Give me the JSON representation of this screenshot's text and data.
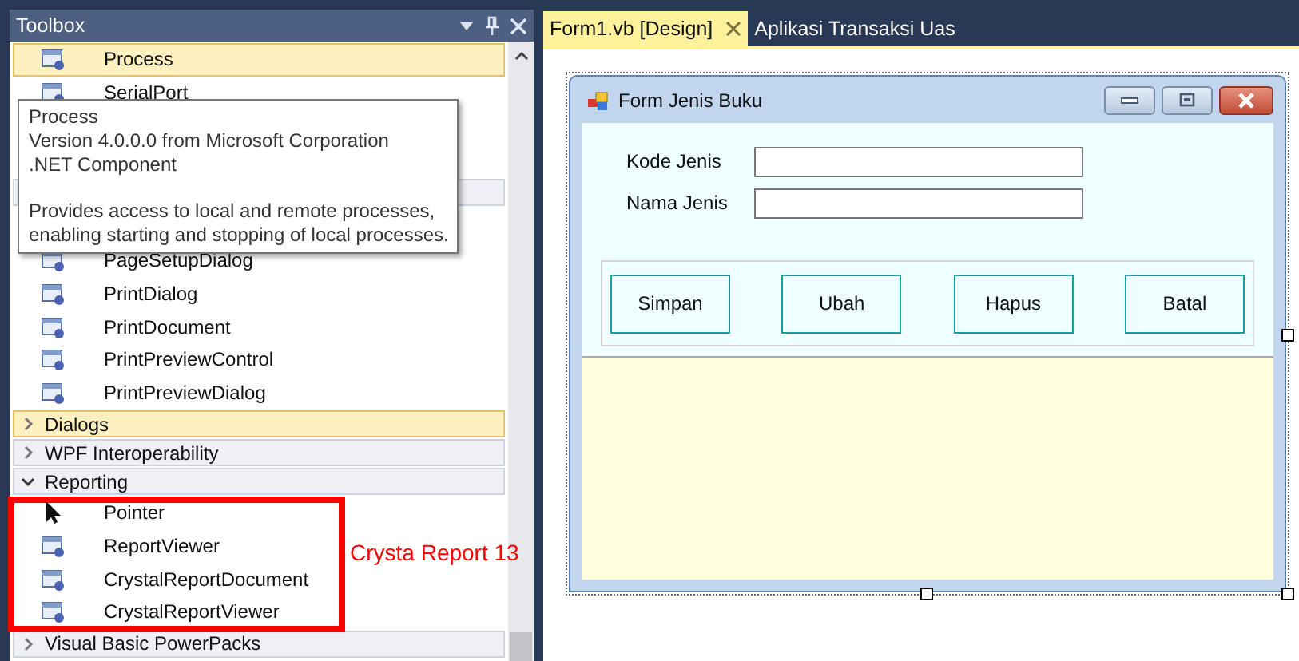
{
  "toolbox": {
    "title": "Toolbox",
    "top_items": [
      {
        "label": "Process",
        "kind": "component",
        "selected": true
      },
      {
        "label": "SerialPort",
        "kind": "component",
        "selected": false
      }
    ],
    "items": [
      {
        "label": "PageSetupDialog",
        "kind": "component",
        "selected": false
      },
      {
        "label": "PrintDialog",
        "kind": "component",
        "selected": false
      },
      {
        "label": "PrintDocument",
        "kind": "component",
        "selected": false
      },
      {
        "label": "PrintPreviewControl",
        "kind": "component",
        "selected": false
      },
      {
        "label": "PrintPreviewDialog",
        "kind": "component",
        "selected": false
      }
    ],
    "categories": [
      {
        "label": "Dialogs",
        "expanded": false,
        "selected": true
      },
      {
        "label": "WPF Interoperability",
        "expanded": false,
        "selected": false
      },
      {
        "label": "Reporting",
        "expanded": true,
        "selected": false,
        "items": [
          {
            "label": "Pointer",
            "kind": "pointer",
            "selected": false
          },
          {
            "label": "ReportViewer",
            "kind": "component",
            "selected": false
          },
          {
            "label": "CrystalReportDocument",
            "kind": "component",
            "selected": false
          },
          {
            "label": "CrystalReportViewer",
            "kind": "component",
            "selected": false
          }
        ]
      },
      {
        "label": "Visual Basic PowerPacks",
        "expanded": false,
        "selected": false
      }
    ]
  },
  "tooltip": {
    "title": "Process",
    "lines": [
      "Version 4.0.0.0 from Microsoft Corporation",
      ".NET Component"
    ],
    "description_lines": [
      "Provides access to local and remote processes,",
      "enabling starting and stopping of local processes."
    ]
  },
  "annotation": {
    "text": "Crysta Report 13"
  },
  "tabs": [
    {
      "label": "Form1.vb [Design]",
      "selected": true
    },
    {
      "label": "Aplikasi Transaksi Uas",
      "selected": false
    }
  ],
  "form": {
    "title": "Form Jenis Buku",
    "fields": [
      {
        "label": "Kode Jenis"
      },
      {
        "label": "Nama Jenis"
      }
    ],
    "buttons": [
      "Simpan",
      "Ubah",
      "Hapus",
      "Batal"
    ]
  }
}
